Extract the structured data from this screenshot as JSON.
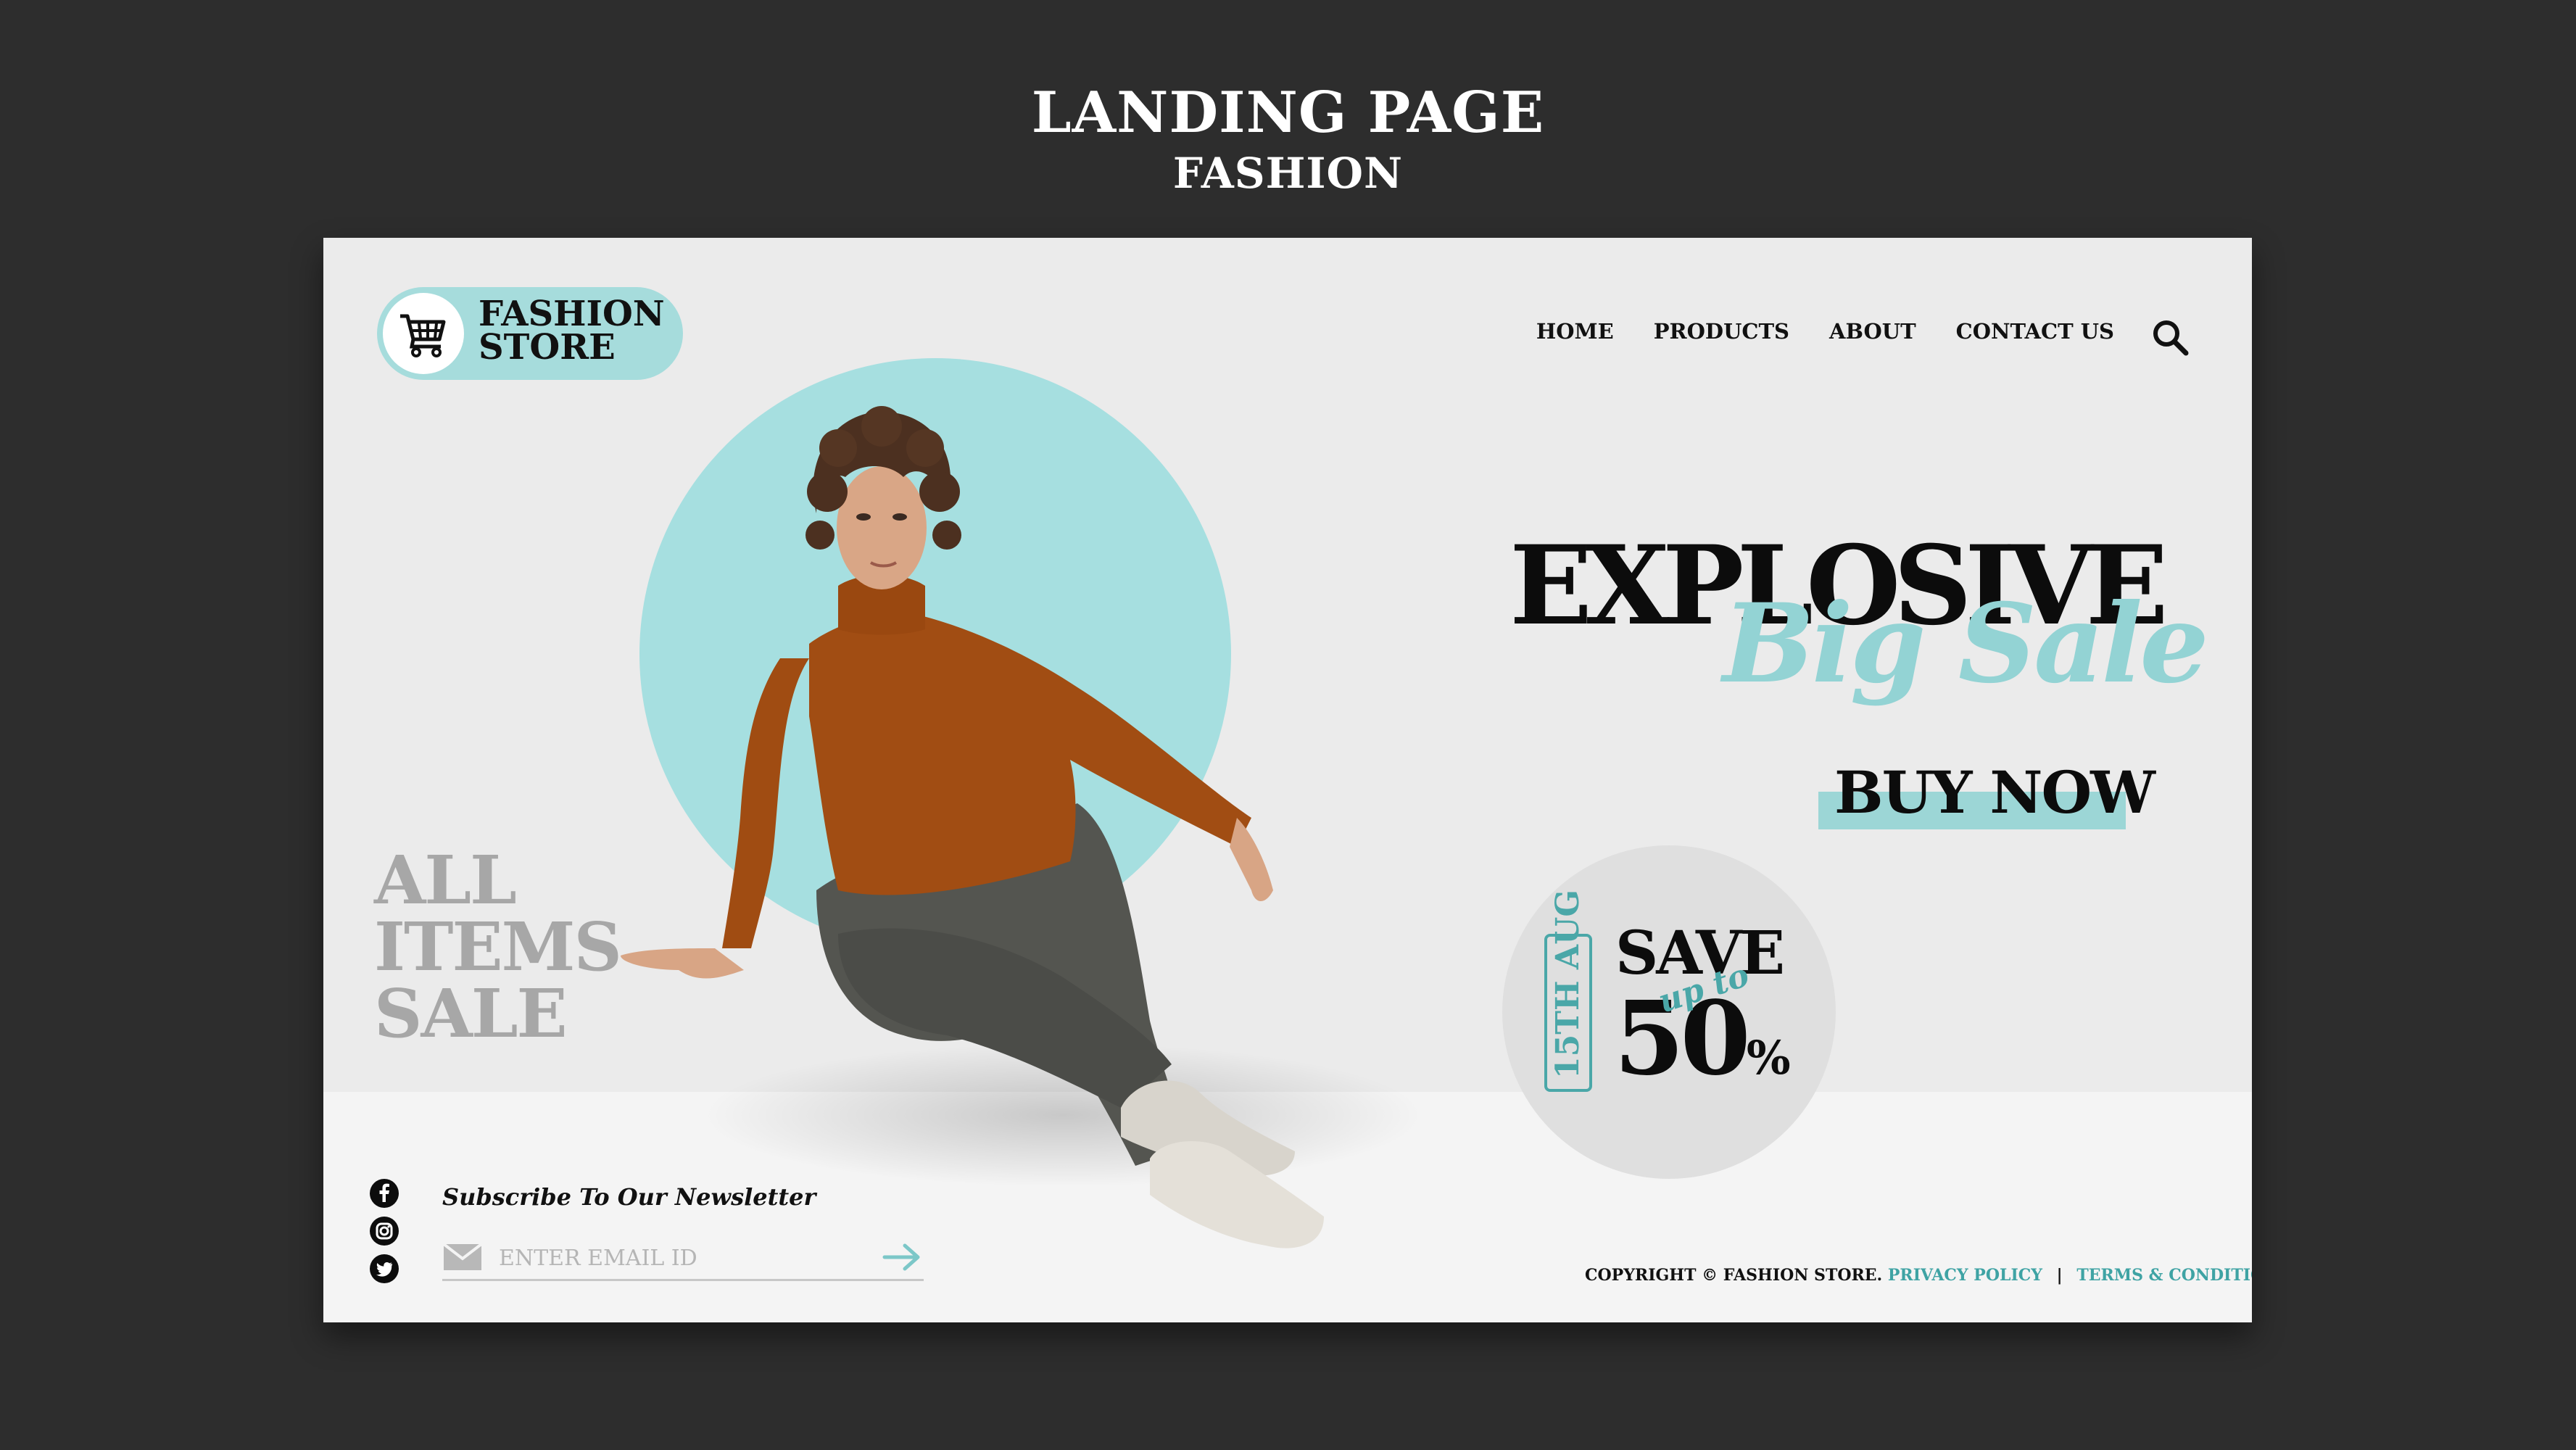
{
  "header": {
    "title": "LANDING PAGE",
    "subtitle": "FASHION"
  },
  "logo": {
    "line1": "FASHION",
    "line2": "STORE",
    "icon": "shopping-cart-icon"
  },
  "nav": {
    "items": [
      "HOME",
      "PRODUCTS",
      "ABOUT",
      "CONTACT US"
    ],
    "search_icon": "search-icon"
  },
  "hero": {
    "headline": "EXPLOSIVE",
    "script": "Big Sale",
    "cta": "BUY NOW",
    "side_text": [
      "ALL",
      "ITEMS",
      "SALE"
    ]
  },
  "promo": {
    "date": "15TH AUG",
    "save": "SAVE",
    "up_to": "up to",
    "amount": "50",
    "percent": "%"
  },
  "newsletter": {
    "title": "Subscribe To Our Newsletter",
    "placeholder": "ENTER EMAIL ID"
  },
  "social": [
    "facebook-icon",
    "instagram-icon",
    "twitter-icon"
  ],
  "footer": {
    "copyright": "COPYRIGHT © FASHION STORE.",
    "privacy": "PRIVACY POLICY",
    "separator": "|",
    "terms": "TERMS & CONDITIONS"
  },
  "colors": {
    "background": "#2d2d2d",
    "page": "#ebebeb",
    "accent": "#a6dcdc",
    "accent_dark": "#3fa3a4"
  }
}
